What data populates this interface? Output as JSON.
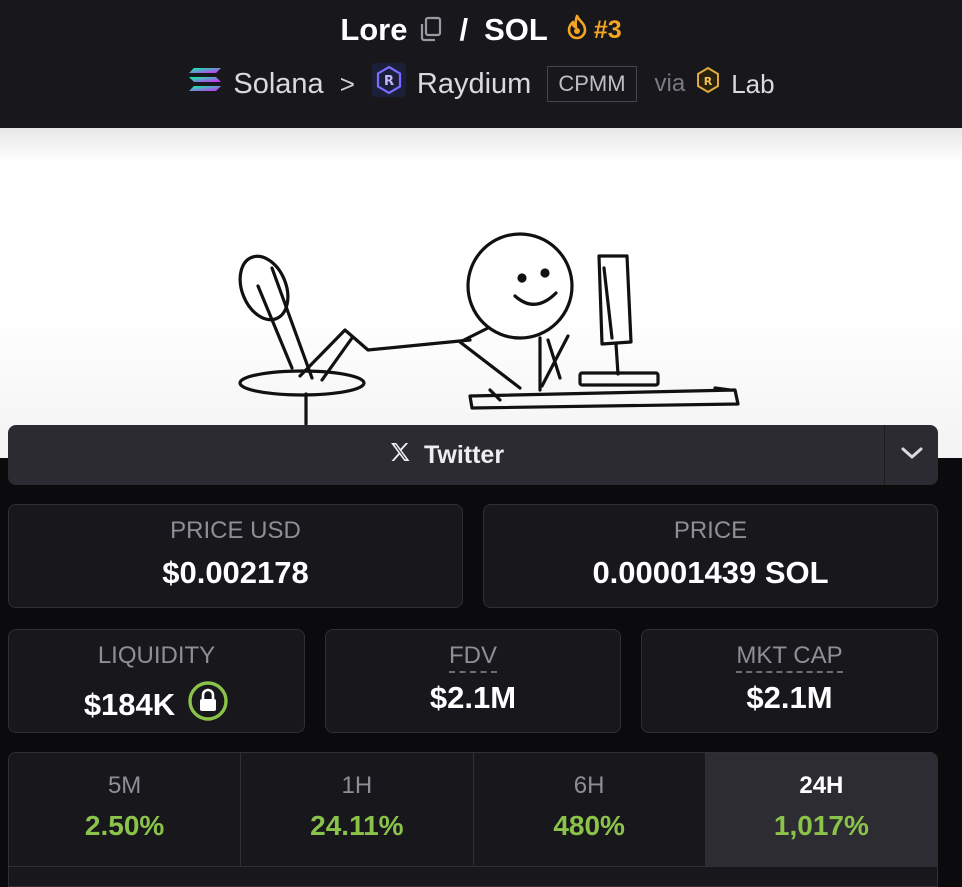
{
  "header": {
    "token": "Lore",
    "separator": "/",
    "quote": "SOL",
    "rank": "#3",
    "chain": "Solana",
    "chevron": ">",
    "dex": "Raydium",
    "pool_type": "CPMM",
    "via": "via",
    "launchpad": "Lab"
  },
  "social": {
    "twitter_label": "Twitter"
  },
  "stats": {
    "price_usd_label": "PRICE USD",
    "price_usd_value": "$0.002178",
    "price_label": "PRICE",
    "price_value": "0.00001439 SOL",
    "liquidity_label": "LIQUIDITY",
    "liquidity_value": "$184K",
    "fdv_label": "FDV",
    "fdv_value": "$2.1M",
    "mktcap_label": "MKT CAP",
    "mktcap_value": "$2.1M"
  },
  "timeframes": [
    {
      "label": "5M",
      "change": "2.50%"
    },
    {
      "label": "1H",
      "change": "24.11%"
    },
    {
      "label": "6H",
      "change": "480%"
    },
    {
      "label": "24H",
      "change": "1,017%"
    }
  ],
  "colors": {
    "positive": "#8bc34a",
    "rank": "#f5a524",
    "liquidity_lock": "#8bc34a"
  }
}
